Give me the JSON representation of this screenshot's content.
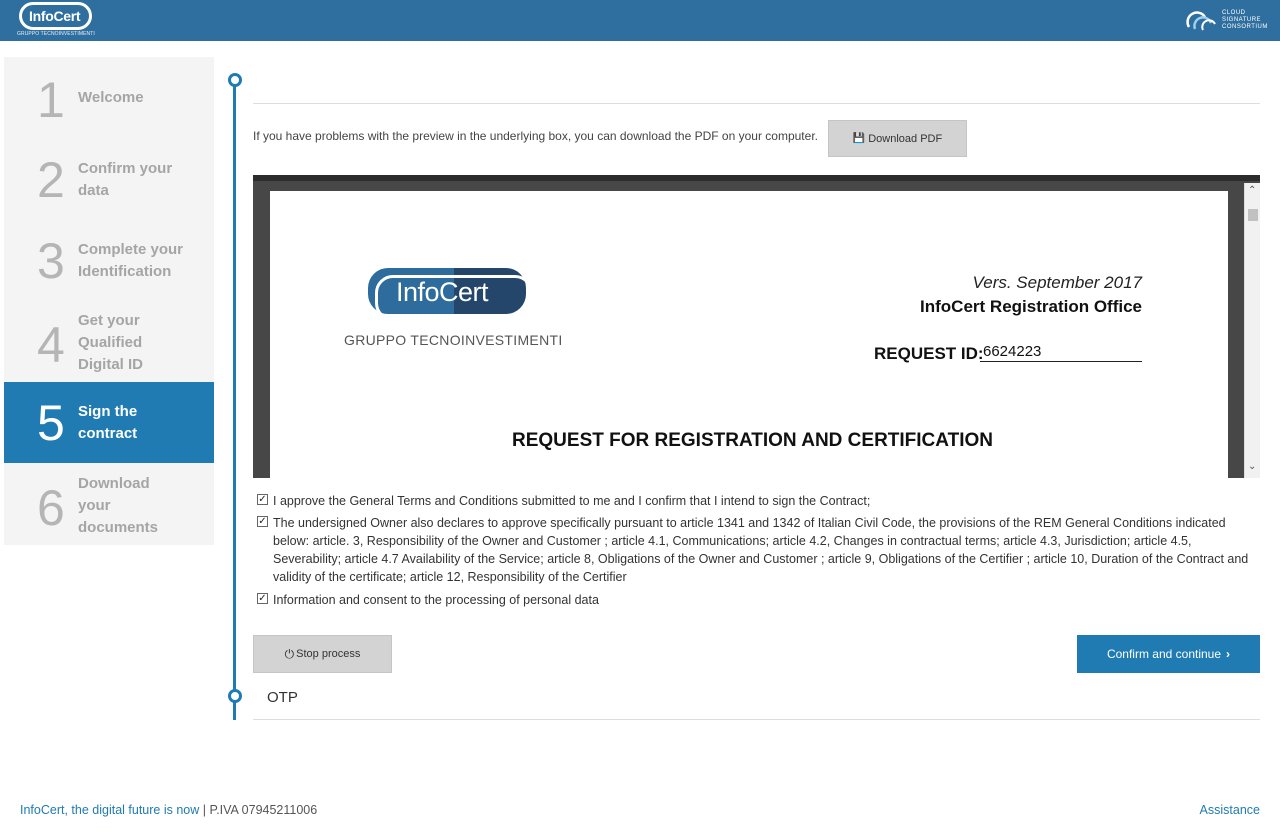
{
  "header": {
    "logo_text": "InfoCert",
    "logo_subtext": "GRUPPO TECNOINVESTIMENTI",
    "partner_logo_lines": [
      "CLOUD",
      "SIGNATURE",
      "CONSORTIUM"
    ]
  },
  "steps": [
    {
      "number": "1",
      "label": "Welcome"
    },
    {
      "number": "2",
      "label": "Confirm your data"
    },
    {
      "number": "3",
      "label": "Complete your Identification"
    },
    {
      "number": "4",
      "label": "Get your Qualified Digital ID"
    },
    {
      "number": "5",
      "label": "Sign the contract",
      "active": true
    },
    {
      "number": "6",
      "label": "Download your documents"
    }
  ],
  "preview": {
    "notice": "If you have problems with the preview in the underlying box, you can download the PDF on your computer.",
    "download_label": "Download PDF"
  },
  "document": {
    "logo_text": "InfoCert",
    "logo_subtext": "GRUPPO TECNOINVESTIMENTI",
    "version": "Vers. September 2017",
    "office": "InfoCert Registration Office",
    "request_id_label": "REQUEST ID:",
    "request_id_value": "6624223",
    "title": "REQUEST FOR REGISTRATION AND CERTIFICATION"
  },
  "consents": [
    {
      "checked": true,
      "text": "I approve the General Terms and Conditions submitted to me and I confirm that I intend to sign the Contract;"
    },
    {
      "checked": true,
      "text": "The undersigned Owner also declares to approve specifically pursuant to article 1341 and 1342 of Italian Civil Code, the provisions of the REM General Conditions indicated below: article. 3, Responsibility of the Owner and Customer ; article 4.1, Communications; article 4.2, Changes in contractual terms; article 4.3, Jurisdiction; article 4.5, Severability; article 4.7 Availability of the Service; article 8, Obligations of the Owner and Customer ; article 9, Obligations of the Certifier ; article 10, Duration of the Contract and validity of the certificate; article 12, Responsibility of the Certifier"
    },
    {
      "checked": true,
      "text": "Information and consent to the processing of personal data"
    }
  ],
  "actions": {
    "stop_label": "Stop process",
    "confirm_label": "Confirm and continue"
  },
  "next_section": "OTP",
  "footer": {
    "tagline": "InfoCert, the digital future is now",
    "separator": " | ",
    "vat": "P.IVA 07945211006",
    "assistance": "Assistance"
  },
  "colors": {
    "header_bg": "#2f6f9f",
    "accent": "#1f7bb2",
    "button_grey": "#d3d3d3"
  }
}
